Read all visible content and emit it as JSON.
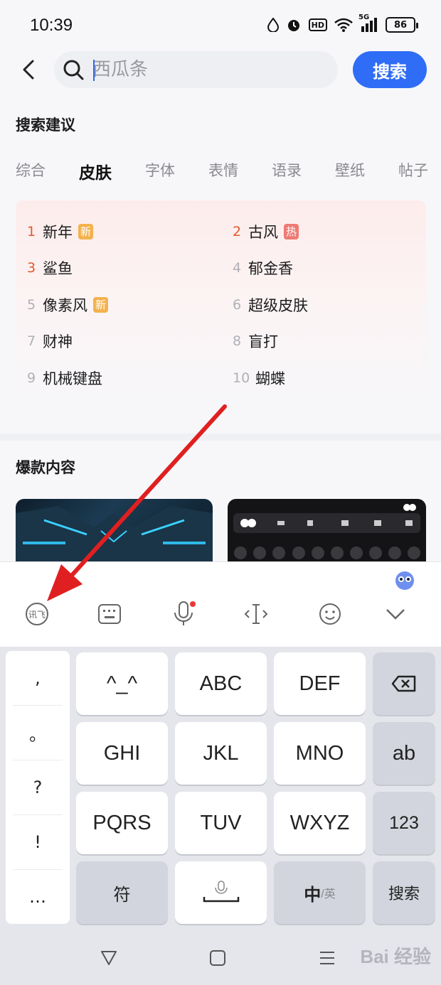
{
  "status_bar": {
    "time": "10:39",
    "network_label": "5G",
    "hd_label": "HD",
    "battery": "86"
  },
  "search": {
    "placeholder": "西瓜条",
    "button_label": "搜索"
  },
  "suggestions": {
    "title": "搜索建议",
    "tabs": [
      {
        "label": "综合",
        "active": false
      },
      {
        "label": "皮肤",
        "active": true
      },
      {
        "label": "字体",
        "active": false
      },
      {
        "label": "表情",
        "active": false
      },
      {
        "label": "语录",
        "active": false
      },
      {
        "label": "壁纸",
        "active": false
      },
      {
        "label": "帖子",
        "active": false
      }
    ],
    "items": [
      {
        "rank": "1",
        "text": "新年",
        "badge": "新"
      },
      {
        "rank": "2",
        "text": "古风",
        "badge": "热"
      },
      {
        "rank": "3",
        "text": "鲨鱼",
        "badge": ""
      },
      {
        "rank": "4",
        "text": "郁金香",
        "badge": ""
      },
      {
        "rank": "5",
        "text": "像素风",
        "badge": "新"
      },
      {
        "rank": "6",
        "text": "超级皮肤",
        "badge": ""
      },
      {
        "rank": "7",
        "text": "财神",
        "badge": ""
      },
      {
        "rank": "8",
        "text": "盲打",
        "badge": ""
      },
      {
        "rank": "9",
        "text": "机械键盘",
        "badge": ""
      },
      {
        "rank": "10",
        "text": "蝴蝶",
        "badge": ""
      }
    ]
  },
  "hot_content": {
    "title": "爆款内容"
  },
  "keyboard": {
    "toolbar": {
      "input_method_icon": "讯飞",
      "keyboard_icon": "keyboard-icon",
      "voice_icon": "microphone-icon",
      "cursor_icon": "cursor-icon",
      "emoji_icon": "smiley-icon",
      "collapse_icon": "chevron-down-icon"
    },
    "punctuation": [
      ",",
      "。",
      "?",
      "!",
      "…"
    ],
    "row1": [
      "^_^",
      "ABC",
      "DEF"
    ],
    "row2": [
      "GHI",
      "JKL",
      "MNO"
    ],
    "row3": [
      "PQRS",
      "TUV",
      "WXYZ"
    ],
    "side": {
      "backspace_icon": "backspace-icon",
      "ab": "ab",
      "num": "123",
      "search": "搜索"
    },
    "bottom": {
      "symbol": "符",
      "space_icon": "microphone-small-icon",
      "lang_main": "中",
      "lang_alt": "/英"
    }
  },
  "watermark": "Bai 经验",
  "colors": {
    "accent": "#2f6df6",
    "rank_red": "#e05a2b",
    "badge_new": "#f3b24d",
    "badge_hot": "#ee7a73",
    "annotation_arrow": "#e02020"
  }
}
